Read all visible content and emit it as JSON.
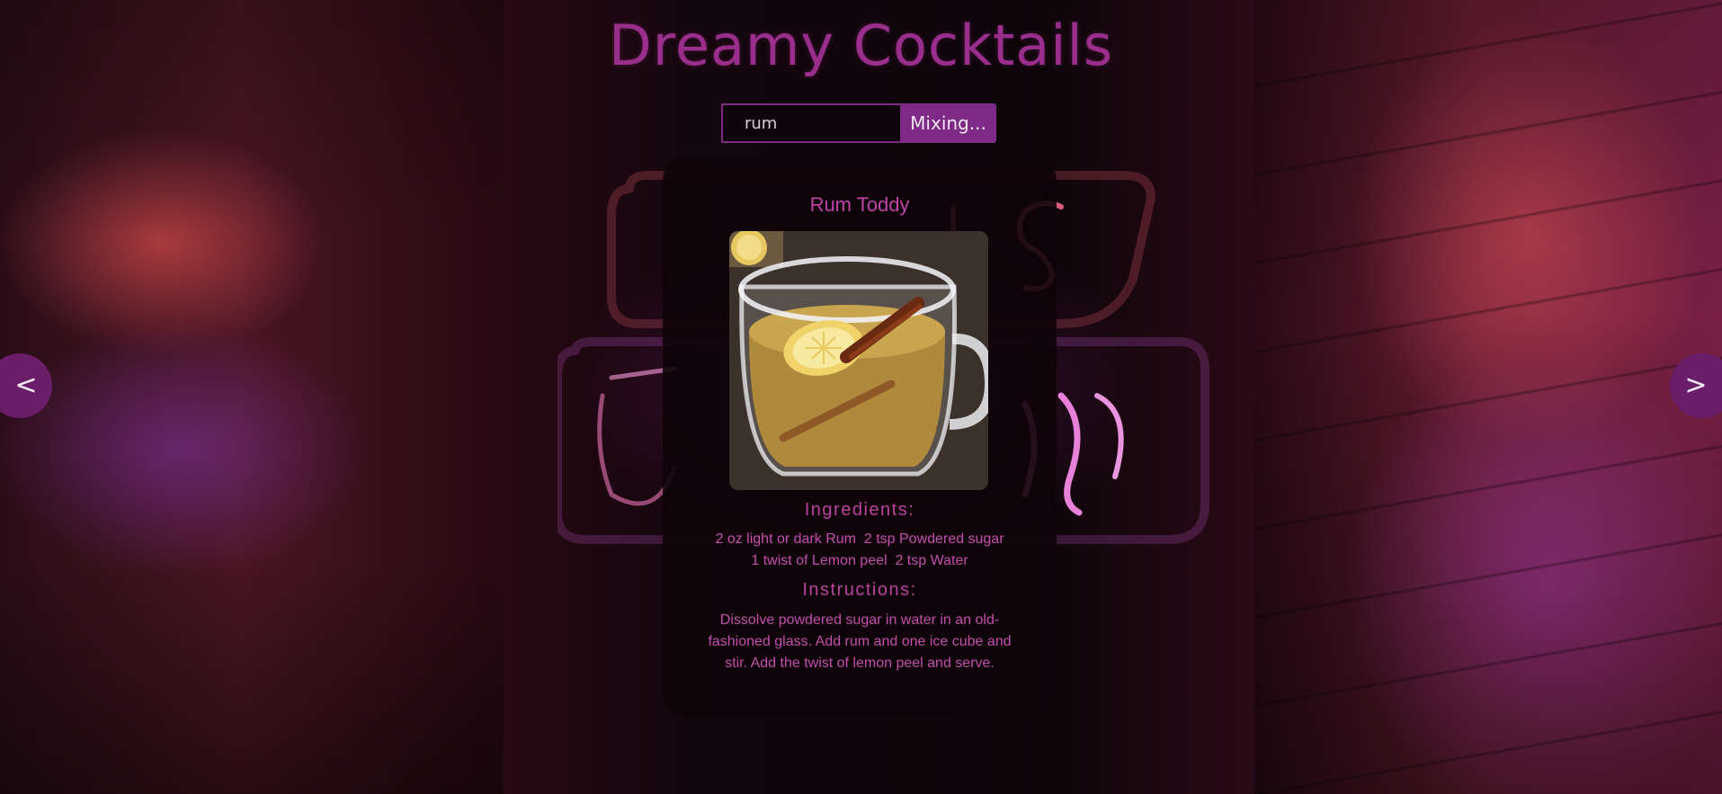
{
  "app": {
    "title": "Dreamy Cocktails"
  },
  "search": {
    "value": "rum",
    "button_label": "Mixing..."
  },
  "navigation": {
    "prev_label": "<",
    "next_label": ">"
  },
  "drink": {
    "name": "Rum Toddy",
    "image_icon": "hot-toddy-glass-image",
    "ingredients_heading": "Ingredients:",
    "ingredients": [
      "2 oz light or dark Rum",
      "2 tsp Powdered sugar",
      "1 twist of Lemon peel",
      "2 tsp Water"
    ],
    "instructions_heading": "Instructions:",
    "instructions": "Dissolve powdered sugar in water in an old-fashioned glass. Add rum and one ice cube and stir. Add the twist of lemon peel and serve."
  },
  "colors": {
    "accent": "#7e2a86",
    "title": "#9a2e8c",
    "card_text": "#c24fad",
    "card_background": "#0e0308"
  }
}
